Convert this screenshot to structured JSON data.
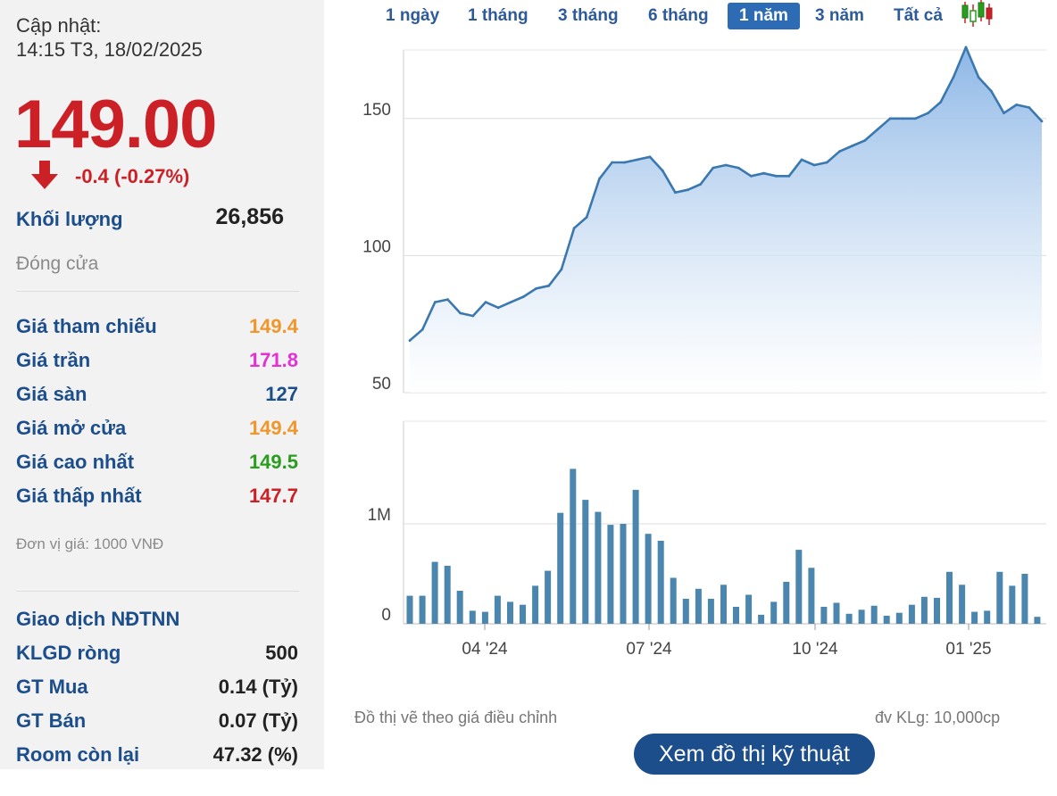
{
  "quote": {
    "updated_label": "Cập nhật:",
    "updated_time": "14:15 T3, 18/02/2025",
    "price": "149.00",
    "change": "-0.4 (-0.27%)",
    "volume_label": "Khối lượng",
    "volume_value": "26,856",
    "status": "Đóng cửa",
    "rows": [
      {
        "label": "Giá tham chiếu",
        "value": "149.4",
        "color": "#f0962a"
      },
      {
        "label": "Giá trần",
        "value": "171.8",
        "color": "#e331d3"
      },
      {
        "label": "Giá sàn",
        "value": "127",
        "color": "#1d4e8c"
      },
      {
        "label": "Giá mở cửa",
        "value": "149.4",
        "color": "#f0962a"
      },
      {
        "label": "Giá cao nhất",
        "value": "149.5",
        "color": "#2a9d1f"
      },
      {
        "label": "Giá thấp nhất",
        "value": "147.7",
        "color": "#cc2027"
      }
    ],
    "unit_note": "Đơn vị giá: 1000 VNĐ",
    "foreign_title": "Giao dịch NĐTNN",
    "foreign_rows": [
      {
        "label": "KLGD ròng",
        "value": "500"
      },
      {
        "label": "GT Mua",
        "value": "0.14 (Tỷ)"
      },
      {
        "label": "GT Bán",
        "value": "0.07 (Tỷ)"
      },
      {
        "label": "Room còn lại",
        "value": "47.32 (%)"
      }
    ]
  },
  "tabs": [
    {
      "label": "1 ngày"
    },
    {
      "label": "1 tháng"
    },
    {
      "label": "3 tháng"
    },
    {
      "label": "6 tháng"
    },
    {
      "label": "1 năm",
      "active": true
    },
    {
      "label": "3 năm"
    },
    {
      "label": "Tất cả"
    }
  ],
  "icons": {
    "candlestick": "candlestick-chart-icon",
    "down_arrow": "red-down-arrow-icon"
  },
  "colors": {
    "up": "#2a9d1f",
    "down": "#cc2027",
    "line": "#3b78b0",
    "bar": "#4a86ad",
    "accent": "#2d6cb5"
  },
  "chart_data": [
    {
      "type": "area",
      "x_tick_labels": [
        "04 '24",
        "07 '24",
        "10 '24",
        "01 '25"
      ],
      "y_ticks": [
        50,
        100,
        150
      ],
      "ylim": [
        50,
        175
      ],
      "grid": true,
      "values": [
        69,
        73,
        83,
        84,
        79,
        78,
        83,
        81,
        83,
        85,
        88,
        89,
        95,
        110,
        114,
        128,
        134,
        134,
        135,
        136,
        131,
        123,
        124,
        126,
        132,
        133,
        132,
        129,
        130,
        129,
        129,
        135,
        133,
        134,
        138,
        140,
        142,
        146,
        150,
        150,
        150,
        152,
        156,
        165,
        176,
        165,
        160,
        152,
        155,
        154,
        149
      ]
    },
    {
      "type": "bar",
      "y_ticks": [
        "0",
        "1M"
      ],
      "ylim": [
        0,
        1.55
      ],
      "grid": true,
      "values": [
        0.28,
        0.28,
        0.62,
        0.58,
        0.33,
        0.13,
        0.12,
        0.28,
        0.22,
        0.19,
        0.38,
        0.53,
        1.11,
        1.55,
        1.24,
        1.12,
        0.99,
        1.0,
        1.34,
        0.9,
        0.83,
        0.46,
        0.25,
        0.35,
        0.25,
        0.39,
        0.17,
        0.29,
        0.09,
        0.22,
        0.42,
        0.74,
        0.56,
        0.17,
        0.21,
        0.1,
        0.14,
        0.18,
        0.08,
        0.11,
        0.19,
        0.27,
        0.26,
        0.52,
        0.39,
        0.12,
        0.13,
        0.52,
        0.38,
        0.5,
        0.07
      ]
    }
  ],
  "footer": {
    "adjusted_note": "Đồ thị vẽ theo giá điều chỉnh",
    "volume_unit": "đv KLg: 10,000cp",
    "tech_button": "Xem đồ thị kỹ thuật"
  }
}
